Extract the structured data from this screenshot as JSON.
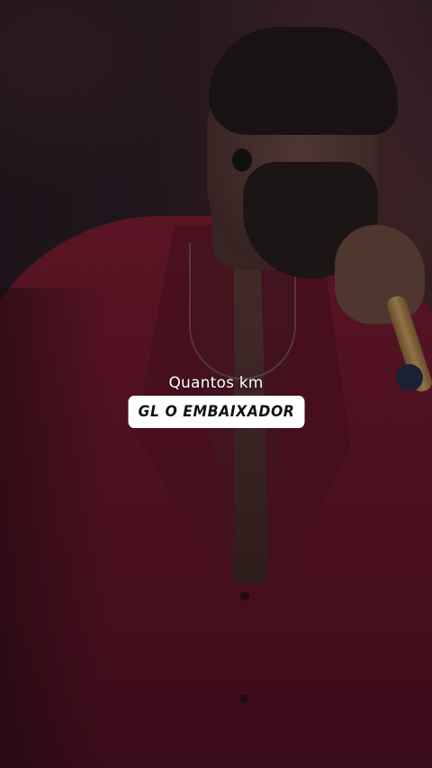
{
  "caption": {
    "song_title": "Quantos km",
    "artist": "GL O EMBAIXADOR"
  },
  "colors": {
    "jacket": "#6a1428",
    "background": "#1b161c",
    "tag_background": "#ffffff",
    "tag_text": "#111111",
    "caption_text": "#ffffff"
  }
}
